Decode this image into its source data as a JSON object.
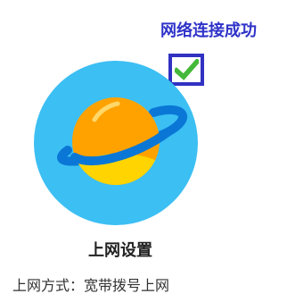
{
  "status": {
    "text": "网络连接成功",
    "icon": "checkmark-icon",
    "color": "#2f33c9",
    "check_color": "#44b83a"
  },
  "internet_settings": {
    "icon": "planet-icon",
    "title": "上网设置",
    "mode_label": "上网方式：",
    "mode_value": "宽带拨号上网"
  },
  "colors": {
    "circle_bg": "#3cbff3",
    "planet_orange": "#ffa200",
    "planet_yellow": "#ffd400",
    "ring_blue": "#0a77d6"
  }
}
